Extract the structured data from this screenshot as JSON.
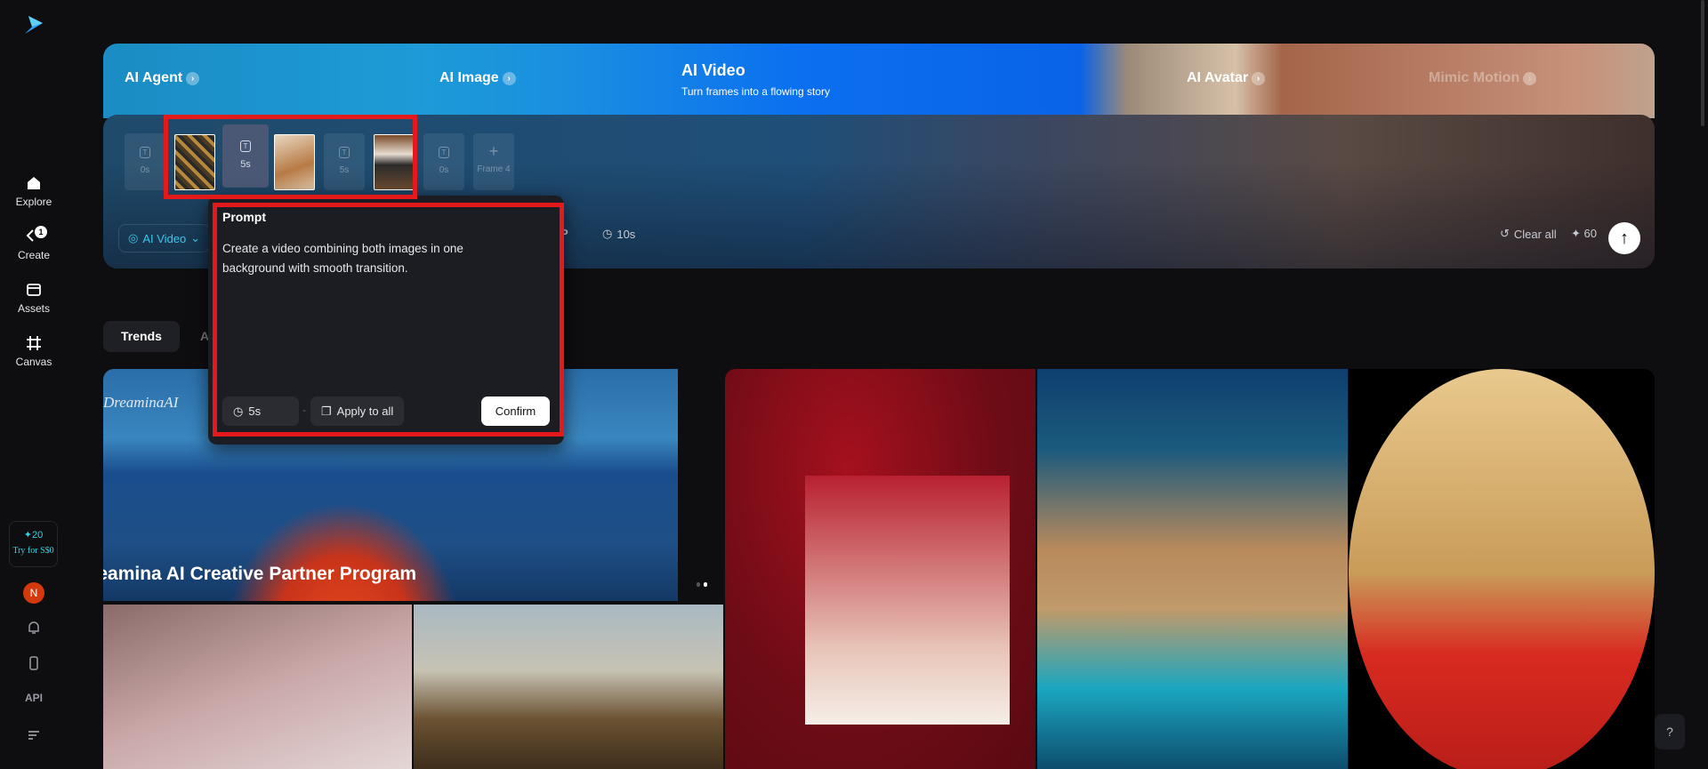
{
  "sidebar": {
    "items": [
      {
        "label": "Explore",
        "icon": "home-icon"
      },
      {
        "label": "Create",
        "icon": "create-icon",
        "badge": "1"
      },
      {
        "label": "Assets",
        "icon": "folder-icon"
      },
      {
        "label": "Canvas",
        "icon": "canvas-icon"
      }
    ],
    "promo": {
      "credits": "✦20",
      "cta": "Try for S$0"
    },
    "avatar": "N",
    "api_label": "API"
  },
  "banner": {
    "tools": [
      {
        "label": "AI Agent"
      },
      {
        "label": "AI Image"
      },
      {
        "label": "AI Video",
        "subtitle": "Turn frames into a flowing story"
      },
      {
        "label": "AI Avatar"
      },
      {
        "label": "Mimic Motion"
      }
    ]
  },
  "frames": {
    "items": [
      {
        "type": "transition",
        "duration": "0s"
      },
      {
        "type": "image"
      },
      {
        "type": "transition",
        "duration": "5s",
        "selected": true
      },
      {
        "type": "image"
      },
      {
        "type": "transition",
        "duration": "5s"
      },
      {
        "type": "image"
      },
      {
        "type": "transition",
        "duration": "0s"
      },
      {
        "type": "add",
        "label": "Frame 4"
      }
    ]
  },
  "toolbar": {
    "mode": "AI Video",
    "partial_label": "P",
    "duration": "10s",
    "clear_all": "Clear all",
    "credits": "✦ 60"
  },
  "prompt_popover": {
    "title": "Prompt",
    "text": "Create a video combining both images  in one background with smooth transition.",
    "duration": "5s",
    "separator": "-",
    "apply_all": "Apply to all",
    "confirm": "Confirm"
  },
  "tabs": {
    "trends": "Trends",
    "partial": "A"
  },
  "gallery": {
    "hero_brand": "DreaminaAI",
    "hero_title": "Dreamina AI Creative Partner Program"
  },
  "help": "?",
  "colors": {
    "accent": "#39c8ea",
    "highlight": "#e3191c",
    "bg": "#0e0e11"
  }
}
